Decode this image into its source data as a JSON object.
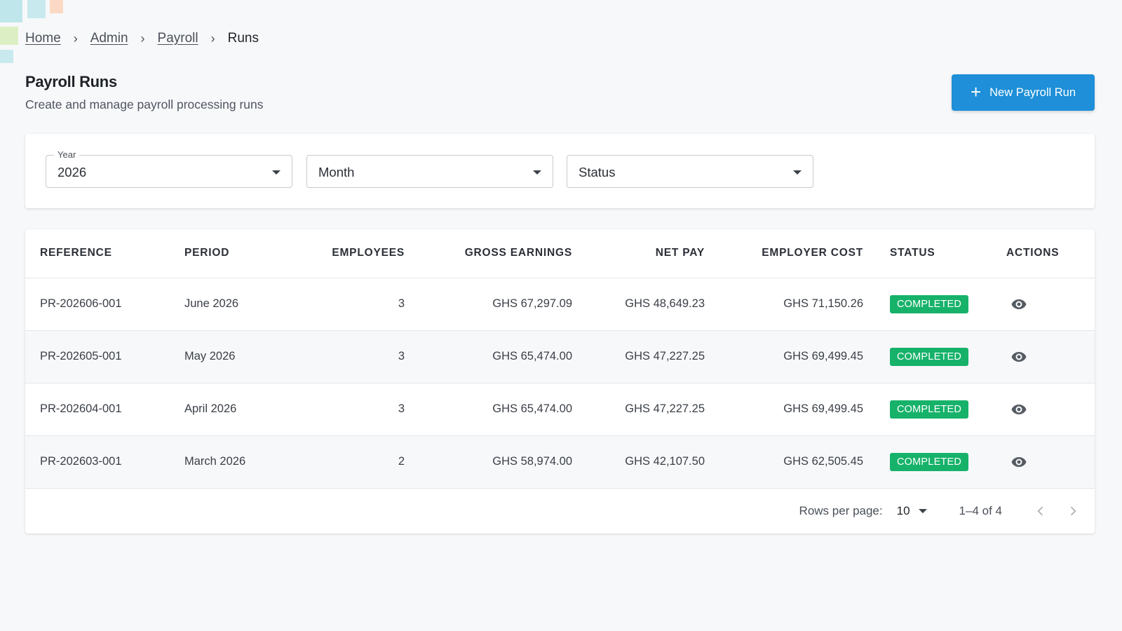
{
  "breadcrumb": {
    "items": [
      "Home",
      "Admin",
      "Payroll"
    ],
    "current": "Runs"
  },
  "page": {
    "title": "Payroll Runs",
    "subtitle": "Create and manage payroll processing runs"
  },
  "actions": {
    "new_run_label": "New Payroll Run",
    "accent_color": "#1e8fd8"
  },
  "filters": {
    "year": {
      "label": "Year",
      "value": "2026"
    },
    "month": {
      "placeholder": "Month"
    },
    "status": {
      "placeholder": "Status"
    }
  },
  "table": {
    "columns": [
      "REFERENCE",
      "PERIOD",
      "EMPLOYEES",
      "GROSS EARNINGS",
      "NET PAY",
      "EMPLOYER COST",
      "STATUS",
      "ACTIONS"
    ],
    "rows": [
      {
        "reference": "PR-202606-001",
        "period": "June 2026",
        "employees": "3",
        "gross": "GHS 67,297.09",
        "net": "GHS 48,649.23",
        "cost": "GHS 71,150.26",
        "status": "COMPLETED",
        "action_icon": "eye-icon"
      },
      {
        "reference": "PR-202605-001",
        "period": "May 2026",
        "employees": "3",
        "gross": "GHS 65,474.00",
        "net": "GHS 47,227.25",
        "cost": "GHS 69,499.45",
        "status": "COMPLETED",
        "action_icon": "eye-icon"
      },
      {
        "reference": "PR-202604-001",
        "period": "April 2026",
        "employees": "3",
        "gross": "GHS 65,474.00",
        "net": "GHS 47,227.25",
        "cost": "GHS 69,499.45",
        "status": "COMPLETED",
        "action_icon": "eye-icon"
      },
      {
        "reference": "PR-202603-001",
        "period": "March 2026",
        "employees": "2",
        "gross": "GHS 58,974.00",
        "net": "GHS 42,107.50",
        "cost": "GHS 62,505.45",
        "status": "COMPLETED",
        "action_icon": "eye-icon"
      }
    ],
    "status_color": "#17b26a"
  },
  "pagination": {
    "rows_per_page_label": "Rows per page:",
    "rows_per_page": "10",
    "range": "1–4 of 4"
  }
}
